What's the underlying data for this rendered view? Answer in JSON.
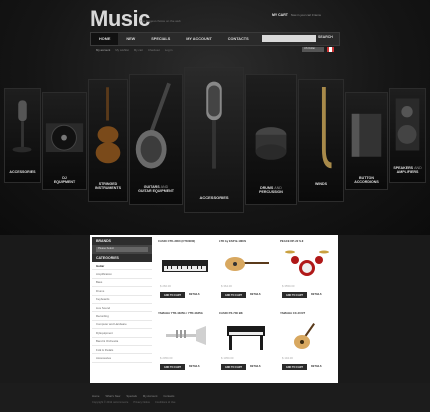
{
  "header": {
    "logo": "Music",
    "tagline": "The biggest choice on the web",
    "cart_label": "MY CART",
    "cart_text": "Now in your cart 0 items"
  },
  "nav": [
    {
      "label": "HOME",
      "active": true
    },
    {
      "label": "NEW"
    },
    {
      "label": "SPECIALS"
    },
    {
      "label": "MY ACCOUNT"
    },
    {
      "label": "CONTACTS"
    }
  ],
  "search": {
    "placeholder": "",
    "button": "SEARCH"
  },
  "subnav": [
    "My account",
    "My wishlist",
    "My cart",
    "Checkout",
    "Log in"
  ],
  "currency": "US Dollar",
  "slides": [
    {
      "label": "ACCESSORIES",
      "label2": ""
    },
    {
      "label": "DJ",
      "label2": "EQUIPMENT"
    },
    {
      "label": "STRINGED",
      "label2": "INSTRUMENTS"
    },
    {
      "label": "GUITARS",
      "label_accent": "AND",
      "label2": "GUITAR EQUIPMENT"
    },
    {
      "label": "ACCESSORIES",
      "label2": ""
    },
    {
      "label": "DRUMS",
      "label_accent": "AND",
      "label2": "PERCUSSION"
    },
    {
      "label": "WINDS",
      "label2": ""
    },
    {
      "label": "BUTTON",
      "label2": "ACCORDIONS"
    },
    {
      "label": "SPEAKERS",
      "label_accent": "AND",
      "label2": "AMPLIFIERS"
    }
  ],
  "sidebar": {
    "brands_title": "BRANDS",
    "brands_select": "Please Select",
    "categories_title": "CATEGORIES",
    "categories": [
      "Guitar",
      "Amplification",
      "Bass",
      "Drums",
      "Keyboards",
      "Live Sound",
      "Recording",
      "Computer and Hardware",
      "Dj Equipment",
      "Band & Orchestra",
      "Folk & Pedals",
      "Accessories"
    ]
  },
  "products": [
    {
      "name": "CASIO CTK-3000 (CTK3000)",
      "price": "$ 260.00",
      "add": "ADD TO CART",
      "details": "DETAILS",
      "img": "keyboard-image"
    },
    {
      "name": "LTD by ESP B-10KIS",
      "price": "$ 364.00",
      "add": "ADD TO CART",
      "details": "DETAILS",
      "img": "bass-guitar-image"
    },
    {
      "name": "PEACE DP-22 S.II",
      "price": "$ 3550.00",
      "add": "ADD TO CART",
      "details": "DETAILS",
      "img": "drum-kit-image"
    },
    {
      "name": "YAMAHA YTR-4335G / YTR-4335G",
      "price": "$ 2050.00",
      "add": "ADD TO CART",
      "details": "DETAILS",
      "img": "trumpet-image"
    },
    {
      "name": "CASIO PX-730 BK",
      "price": "$ 1050.00",
      "add": "ADD TO CART",
      "details": "DETAILS",
      "img": "digital-piano-image"
    },
    {
      "name": "YAMAHA CX-40 NT",
      "price": "$ 194.00",
      "add": "ADD TO CART",
      "details": "DETAILS",
      "img": "acoustic-guitar-image"
    }
  ],
  "footer": {
    "links": [
      "Home",
      "What's New",
      "Specials",
      "My Account",
      "Contacts"
    ],
    "copyright": "Copyright © 2012 osCommerce",
    "privacy": "Privacy Notice",
    "conditions": "Conditions of Use"
  }
}
